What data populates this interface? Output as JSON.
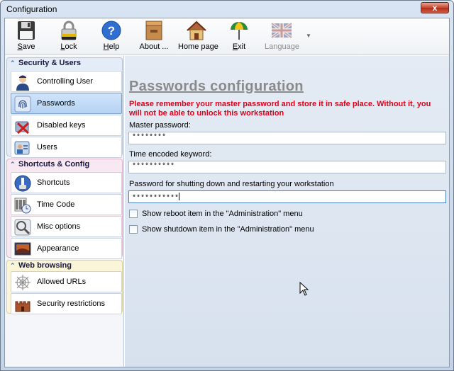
{
  "window": {
    "title": "Configuration",
    "close_glyph": "x"
  },
  "toolbar": {
    "items": [
      {
        "label": "Save",
        "icon": "floppy-disk-icon"
      },
      {
        "label": "Lock",
        "icon": "padlock-icon"
      },
      {
        "label": "Help",
        "icon": "help-icon"
      },
      {
        "label": "About ...",
        "icon": "box-icon"
      },
      {
        "label": "Home page",
        "icon": "home-icon"
      },
      {
        "label": "Exit",
        "icon": "exit-icon"
      },
      {
        "label": "Language",
        "icon": "uk-flag-icon",
        "disabled": true
      }
    ]
  },
  "sidebar": {
    "groups": [
      {
        "title": "Security & Users",
        "items": [
          {
            "label": "Controlling User",
            "icon": "user-icon"
          },
          {
            "label": "Passwords",
            "icon": "fingerprint-icon",
            "selected": true
          },
          {
            "label": "Disabled keys",
            "icon": "disabled-keys-icon"
          },
          {
            "label": "Users",
            "icon": "users-icon"
          }
        ]
      },
      {
        "title": "Shortcuts & Config",
        "items": [
          {
            "label": "Shortcuts",
            "icon": "shortcuts-icon"
          },
          {
            "label": "Time Code",
            "icon": "barcode-clock-icon"
          },
          {
            "label": "Misc options",
            "icon": "misc-options-icon"
          },
          {
            "label": "Appearance",
            "icon": "appearance-icon"
          }
        ]
      },
      {
        "title": "Web browsing",
        "items": [
          {
            "label": "Allowed URLs",
            "icon": "web-icon"
          },
          {
            "label": "Security restrictions",
            "icon": "castle-icon"
          }
        ]
      }
    ]
  },
  "main": {
    "title": "Passwords configuration",
    "warning": "Please remember your master password and store it in safe place. Without it, you will not be able to unlock this workstation",
    "fields": [
      {
        "label": "Master password:",
        "value": "********"
      },
      {
        "label": "Time encoded keyword:",
        "value": "**********"
      },
      {
        "label": "Password for shutting down and restarting your workstation",
        "value": "***********"
      }
    ],
    "checkboxes": [
      {
        "label": "Show reboot item in the \"Administration\" menu",
        "checked": false
      },
      {
        "label": "Show shutdown item in the \"Administration\" menu",
        "checked": false
      }
    ]
  }
}
